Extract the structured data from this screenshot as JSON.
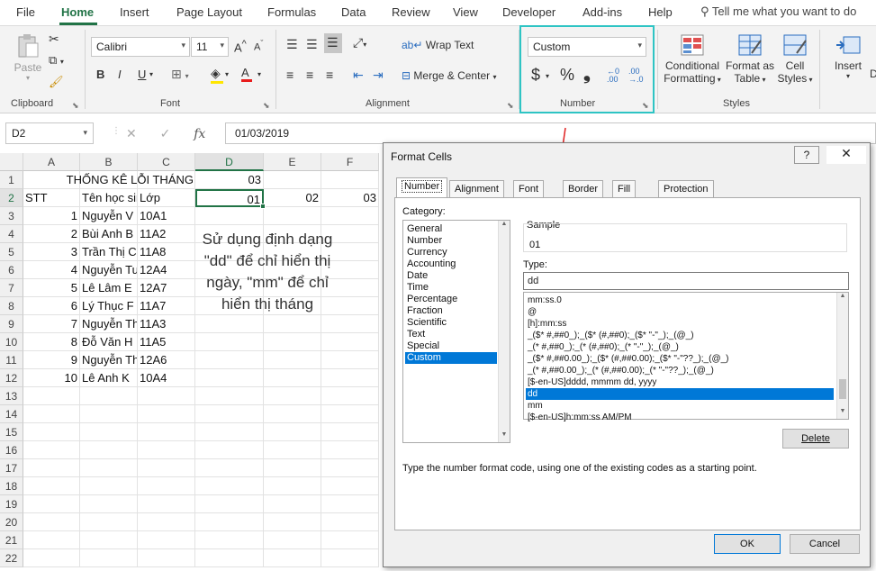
{
  "tabs": [
    {
      "label": "File",
      "active": false
    },
    {
      "label": "Home",
      "active": true
    },
    {
      "label": "Insert",
      "active": false
    },
    {
      "label": "Page Layout",
      "active": false
    },
    {
      "label": "Formulas",
      "active": false
    },
    {
      "label": "Data",
      "active": false
    },
    {
      "label": "Review",
      "active": false
    },
    {
      "label": "View",
      "active": false
    },
    {
      "label": "Developer",
      "active": false
    },
    {
      "label": "Add-ins",
      "active": false
    },
    {
      "label": "Help",
      "active": false
    }
  ],
  "tell_me": "Tell me what you want to do",
  "ribbon": {
    "clipboard": {
      "label": "Clipboard",
      "paste": "Paste"
    },
    "font": {
      "label": "Font",
      "name": "Calibri",
      "size": "11",
      "bold": "B",
      "italic": "I",
      "underline": "U"
    },
    "alignment": {
      "label": "Alignment",
      "wrap_text": "Wrap Text",
      "merge_center": "Merge & Center"
    },
    "number": {
      "label": "Number",
      "format": "Custom",
      "currency": "$",
      "percent": "%",
      "comma": "❟"
    },
    "styles": {
      "label": "Styles",
      "conditional": "Conditional",
      "formatting": "Formatting",
      "format_as": "Format as",
      "table": "Table",
      "cell": "Cell",
      "styles": "Styles"
    },
    "cells": {
      "insert": "Insert"
    }
  },
  "formula_bar": {
    "name_box": "D2",
    "fx": "fx",
    "value": "01/03/2019"
  },
  "sheet": {
    "columns": [
      "A",
      "B",
      "C",
      "D",
      "E",
      "F"
    ],
    "rows": [
      "1",
      "2",
      "3",
      "4",
      "5",
      "6",
      "7",
      "8",
      "9",
      "10",
      "11",
      "12",
      "13",
      "14",
      "15",
      "16",
      "17",
      "18",
      "19",
      "20",
      "21",
      "22"
    ],
    "title": "THỐNG KÊ LỖI THÁNG",
    "month_value": "03",
    "header": {
      "stt": "STT",
      "name": "Tên học sinh",
      "class": "Lớp",
      "d2": "01",
      "e2": "02",
      "f2": "03"
    },
    "data_rows": [
      {
        "stt": "1",
        "name": "Nguyễn V",
        "class": "10A1"
      },
      {
        "stt": "2",
        "name": "Bùi Anh B",
        "class": "11A2"
      },
      {
        "stt": "3",
        "name": "Trần Thị C",
        "class": "11A8"
      },
      {
        "stt": "4",
        "name": "Nguyễn Tu",
        "class": "12A4"
      },
      {
        "stt": "5",
        "name": "Lê Lâm E",
        "class": "12A7"
      },
      {
        "stt": "6",
        "name": "Lý Thục F",
        "class": "11A7"
      },
      {
        "stt": "7",
        "name": "Nguyễn Th",
        "class": "11A3"
      },
      {
        "stt": "8",
        "name": "Đỗ Văn H",
        "class": "11A5"
      },
      {
        "stt": "9",
        "name": "Nguyễn Th",
        "class": "12A6"
      },
      {
        "stt": "10",
        "name": "Lê Anh K",
        "class": "10A4"
      }
    ],
    "note": "Sử dụng định dạng \"dd\" để chỉ hiển thị ngày, \"mm\" để chỉ hiển thị tháng"
  },
  "dialog": {
    "title": "Format Cells",
    "help": "?",
    "close": "✕",
    "tabs": [
      "Number",
      "Alignment",
      "Font",
      "Border",
      "Fill",
      "Protection"
    ],
    "category_label": "Category:",
    "categories": [
      "General",
      "Number",
      "Currency",
      "Accounting",
      "Date",
      "Time",
      "Percentage",
      "Fraction",
      "Scientific",
      "Text",
      "Special",
      "Custom"
    ],
    "selected_category": "Custom",
    "sample_label": "Sample",
    "sample_value": "01",
    "type_label": "Type:",
    "type_value": "dd",
    "formats": [
      "mm:ss.0",
      "@",
      "[h]:mm:ss",
      "_($* #,##0_);_($* (#,##0);_($* \"-\"_);_(@_)",
      "_(* #,##0_);_(* (#,##0);_(* \"-\"_);_(@_)",
      "_($* #,##0.00_);_($* (#,##0.00);_($* \"-\"??_);_(@_)",
      "_(* #,##0.00_);_(* (#,##0.00);_(* \"-\"??_);_(@_)",
      "[$-en-US]dddd, mmmm dd, yyyy",
      "dd",
      "mm",
      "[$-en-US]h:mm:ss AM/PM"
    ],
    "selected_format": "dd",
    "delete": "Delete",
    "description": "Type the number format code, using one of the existing codes as a starting point.",
    "ok": "OK",
    "cancel": "Cancel"
  },
  "colors": {
    "excel_green": "#217346",
    "highlight": "#2ec4c4",
    "arrow": "#e02020",
    "selection": "#0078d7"
  }
}
